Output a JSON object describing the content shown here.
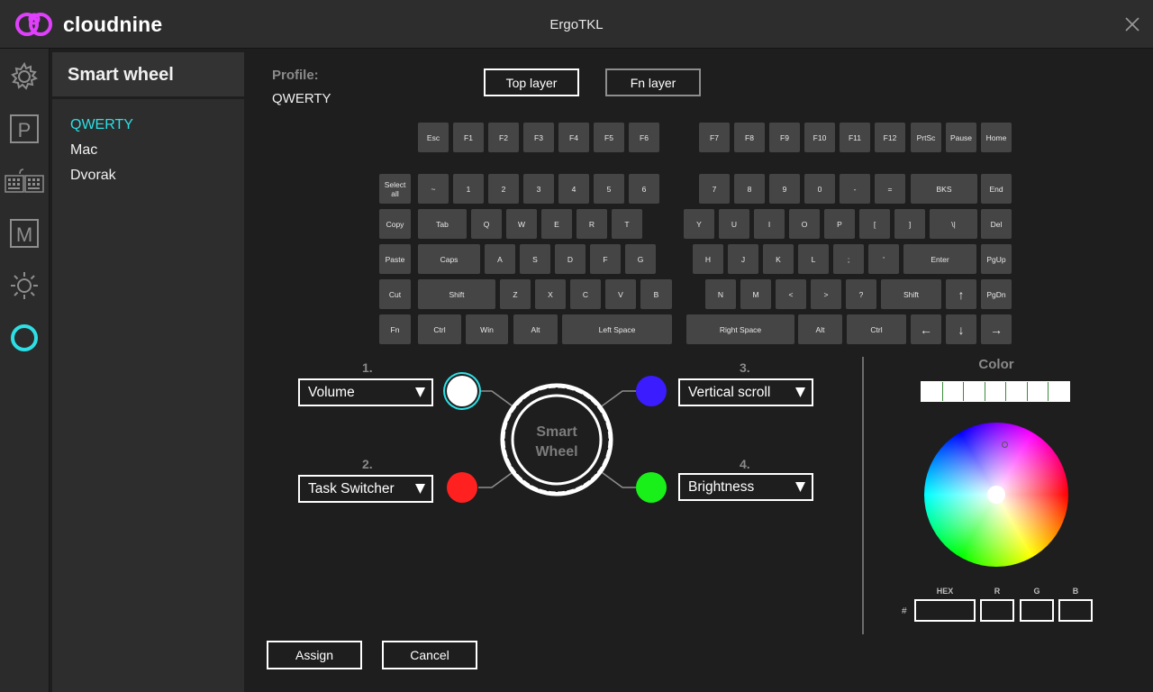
{
  "app": {
    "brand": "cloudnine",
    "window_title": "ErgoTKL",
    "brand_color": "#e040fb",
    "accent_color": "#2de0e6"
  },
  "rail": {
    "icons": [
      "gear-icon",
      "profile-p-icon",
      "keyboard-icon",
      "macro-m-icon",
      "brightness-icon",
      "smart-wheel-icon"
    ],
    "active": "smart-wheel-icon"
  },
  "panel": {
    "title": "Smart wheel",
    "profiles": [
      "QWERTY",
      "Mac",
      "Dvorak"
    ],
    "active_profile": "QWERTY"
  },
  "main": {
    "profile_label": "Profile:",
    "profile_value": "QWERTY",
    "layers": [
      "Top layer",
      "Fn layer"
    ],
    "active_layer": "Top layer"
  },
  "keyboard": {
    "rows": [
      [
        "Esc",
        "F1",
        "F2",
        "F3",
        "F4",
        "F5",
        "F6",
        "F7",
        "F8",
        "F9",
        "F10",
        "F11",
        "F12",
        "PrtSc",
        "Pause",
        "Home"
      ],
      [
        "Select all",
        "~",
        "1",
        "2",
        "3",
        "4",
        "5",
        "6",
        "7",
        "8",
        "9",
        "0",
        "-",
        "=",
        "BKS",
        "End"
      ],
      [
        "Copy",
        "Tab",
        "Q",
        "W",
        "E",
        "R",
        "T",
        "Y",
        "U",
        "I",
        "O",
        "P",
        "[",
        "]",
        "\\|",
        "Del"
      ],
      [
        "Paste",
        "Caps",
        "A",
        "S",
        "D",
        "F",
        "G",
        "H",
        "J",
        "K",
        "L",
        ";",
        "'",
        "Enter",
        "PgUp"
      ],
      [
        "Cut",
        "Shift",
        "Z",
        "X",
        "C",
        "V",
        "B",
        "N",
        "M",
        "<",
        ">",
        "?",
        "Shift",
        "↑",
        "PgDn"
      ],
      [
        "Fn",
        "Ctrl",
        "Win",
        "Alt",
        "Left Space",
        "Right Space",
        "Alt",
        "Ctrl",
        "←",
        "↓",
        "→"
      ]
    ]
  },
  "smart_wheel": {
    "center_label_1": "Smart",
    "center_label_2": "Wheel",
    "slots": [
      {
        "number": "1.",
        "action": "Volume",
        "color": "#ffffff"
      },
      {
        "number": "2.",
        "action": "Task Switcher",
        "color": "#ff2020"
      },
      {
        "number": "3.",
        "action": "Vertical scroll",
        "color": "#3a1cff"
      },
      {
        "number": "4.",
        "action": "Brightness",
        "color": "#19f019"
      }
    ]
  },
  "color_panel": {
    "title": "Color",
    "swatch_count": 7,
    "hex_label": "HEX",
    "r_label": "R",
    "g_label": "G",
    "b_label": "B",
    "hash": "#"
  },
  "actions": {
    "assign": "Assign",
    "cancel": "Cancel"
  }
}
